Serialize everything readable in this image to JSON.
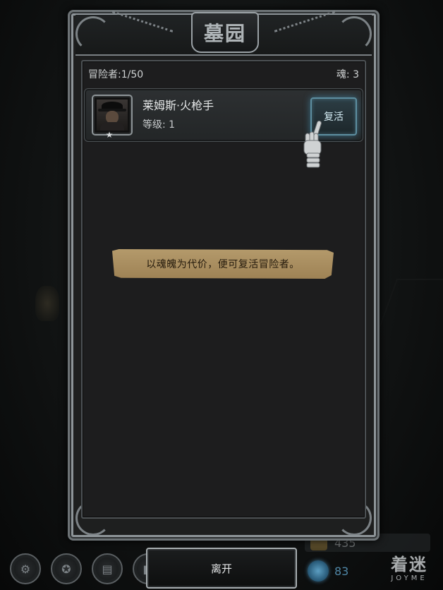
{
  "panel": {
    "title": "墓园",
    "adventurer_count_label": "冒险者:1/50",
    "souls_label": "魂:  3"
  },
  "adventurers": [
    {
      "name": "莱姆斯·火枪手",
      "level_label": "等级:  1",
      "revive_label": "复活"
    }
  ],
  "hint": "以魂魄为代价，便可复活冒险者。",
  "footer": {
    "leave_label": "离开",
    "coin_amount": "435",
    "gem_amount": "83",
    "round_icons": [
      "gear-icon",
      "star-icon",
      "book-icon",
      "scroll-icon"
    ]
  },
  "watermark": {
    "main": "着迷",
    "sub": "JOYME"
  },
  "colors": {
    "revive_glow": "#5d8ea0",
    "banner": "#b49a6b",
    "frame_silver": "#8d9498"
  }
}
